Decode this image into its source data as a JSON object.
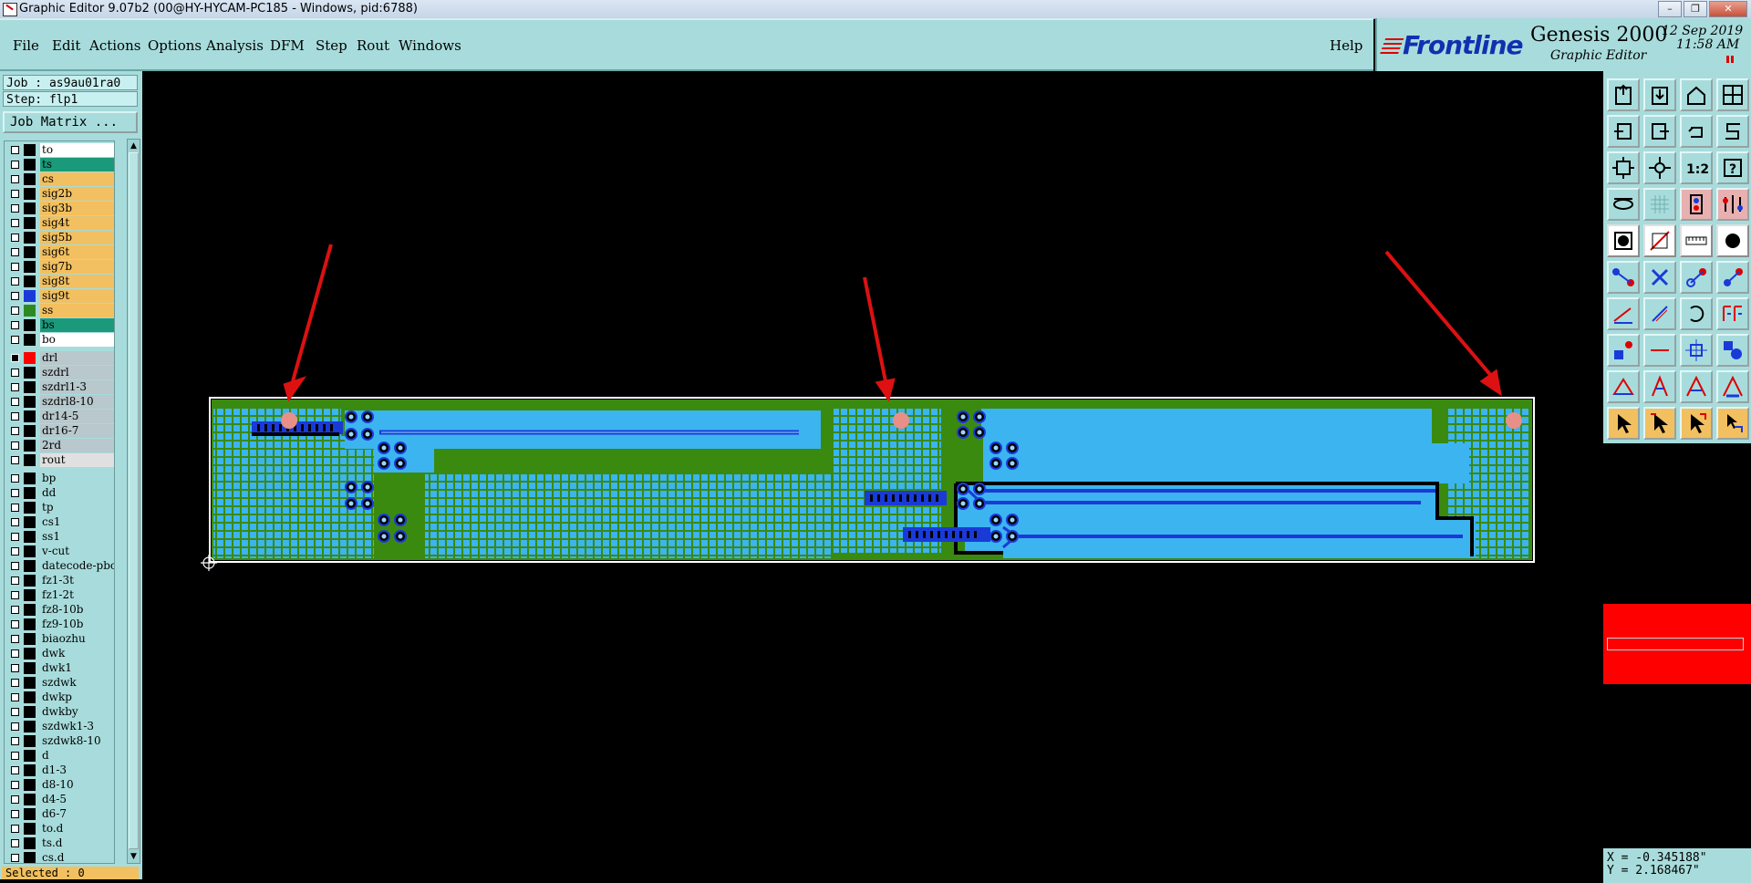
{
  "window": {
    "title": "Graphic Editor 9.07b2 (00@HY-HYCAM-PC185 - Windows, pid:6788)",
    "controls": [
      "–",
      "❐",
      "✕"
    ]
  },
  "menu": {
    "items": [
      "File",
      "Edit",
      "Actions",
      "Options",
      "Analysis",
      "DFM",
      "Step",
      "Rout",
      "Windows"
    ],
    "help": "Help"
  },
  "brand": {
    "logo": "Frontline",
    "product": "Genesis 2000",
    "subtitle": "Graphic Editor",
    "date": "12 Sep 2019",
    "time": "11:58 AM"
  },
  "job": {
    "job_label": "Job : as9au01ra0",
    "step_label": "Step: flp1",
    "matrix_button": "Job Matrix ..."
  },
  "layers": [
    {
      "name": "to",
      "color": "#ffffff",
      "swatch": ""
    },
    {
      "name": "ts",
      "color": "#1a9a7a",
      "swatch": ""
    },
    {
      "name": "cs",
      "color": "#f2c060",
      "swatch": ""
    },
    {
      "name": "sig2b",
      "color": "#f2c060",
      "swatch": ""
    },
    {
      "name": "sig3b",
      "color": "#f2c060",
      "swatch": ""
    },
    {
      "name": "sig4t",
      "color": "#f2c060",
      "swatch": ""
    },
    {
      "name": "sig5b",
      "color": "#f2c060",
      "swatch": ""
    },
    {
      "name": "sig6t",
      "color": "#f2c060",
      "swatch": ""
    },
    {
      "name": "sig7b",
      "color": "#f2c060",
      "swatch": ""
    },
    {
      "name": "sig8t",
      "color": "#f2c060",
      "swatch": ""
    },
    {
      "name": "sig9t",
      "color": "#f2c060",
      "swatch": "#1a3ad8"
    },
    {
      "name": "ss",
      "color": "#f2c060",
      "swatch": "#2e8a20"
    },
    {
      "name": "bs",
      "color": "#1a9a7a",
      "swatch": ""
    },
    {
      "name": "bo",
      "color": "#ffffff",
      "swatch": ""
    },
    {
      "name": "drl",
      "color": "#b8c8cc",
      "swatch": "#ff0000",
      "active": true
    },
    {
      "name": "szdrl",
      "color": "#b8c8cc",
      "swatch": ""
    },
    {
      "name": "szdrl1-3",
      "color": "#b8c8cc",
      "swatch": ""
    },
    {
      "name": "szdrl8-10",
      "color": "#b8c8cc",
      "swatch": ""
    },
    {
      "name": "dr14-5",
      "color": "#b8c8cc",
      "swatch": ""
    },
    {
      "name": "dr16-7",
      "color": "#b8c8cc",
      "swatch": ""
    },
    {
      "name": "2rd",
      "color": "#b8c8cc",
      "swatch": ""
    },
    {
      "name": "rout",
      "color": "#e0e0e0",
      "swatch": ""
    },
    {
      "name": "bp",
      "color": "#a8dcdc",
      "swatch": ""
    },
    {
      "name": "dd",
      "color": "#a8dcdc",
      "swatch": ""
    },
    {
      "name": "tp",
      "color": "#a8dcdc",
      "swatch": ""
    },
    {
      "name": "cs1",
      "color": "#a8dcdc",
      "swatch": ""
    },
    {
      "name": "ss1",
      "color": "#a8dcdc",
      "swatch": ""
    },
    {
      "name": "v-cut",
      "color": "#a8dcdc",
      "swatch": ""
    },
    {
      "name": "datecode-pbo",
      "color": "#a8dcdc",
      "swatch": ""
    },
    {
      "name": "fz1-3t",
      "color": "#a8dcdc",
      "swatch": ""
    },
    {
      "name": "fz1-2t",
      "color": "#a8dcdc",
      "swatch": ""
    },
    {
      "name": "fz8-10b",
      "color": "#a8dcdc",
      "swatch": ""
    },
    {
      "name": "fz9-10b",
      "color": "#a8dcdc",
      "swatch": ""
    },
    {
      "name": "biaozhu",
      "color": "#a8dcdc",
      "swatch": ""
    },
    {
      "name": "dwk",
      "color": "#a8dcdc",
      "swatch": ""
    },
    {
      "name": "dwk1",
      "color": "#a8dcdc",
      "swatch": ""
    },
    {
      "name": "szdwk",
      "color": "#a8dcdc",
      "swatch": ""
    },
    {
      "name": "dwkp",
      "color": "#a8dcdc",
      "swatch": ""
    },
    {
      "name": "dwkby",
      "color": "#a8dcdc",
      "swatch": ""
    },
    {
      "name": "szdwk1-3",
      "color": "#a8dcdc",
      "swatch": ""
    },
    {
      "name": "szdwk8-10",
      "color": "#a8dcdc",
      "swatch": ""
    },
    {
      "name": "d",
      "color": "#a8dcdc",
      "swatch": ""
    },
    {
      "name": "d1-3",
      "color": "#a8dcdc",
      "swatch": ""
    },
    {
      "name": "d8-10",
      "color": "#a8dcdc",
      "swatch": ""
    },
    {
      "name": "d4-5",
      "color": "#a8dcdc",
      "swatch": ""
    },
    {
      "name": "d6-7",
      "color": "#a8dcdc",
      "swatch": ""
    },
    {
      "name": "to.d",
      "color": "#a8dcdc",
      "swatch": ""
    },
    {
      "name": "ts.d",
      "color": "#a8dcdc",
      "swatch": ""
    },
    {
      "name": "cs.d",
      "color": "#a8dcdc",
      "swatch": ""
    }
  ],
  "status": {
    "selected": "Selected : 0",
    "x": "X = -0.345188\"",
    "y": "Y = 2.168467\""
  },
  "colors": {
    "panel": "#a8dcdc",
    "board_green": "#3a8a10",
    "copper_blue": "#3cb4f0",
    "trace_blue": "#1a3ad8",
    "arrow_red": "#dd1111",
    "drill_pink": "#e89088"
  },
  "tools": [
    "new-window-icon",
    "save-view-icon",
    "home-icon",
    "split-view-icon",
    "pan-left-icon",
    "pan-right-icon",
    "redraw-icon",
    "snake-icon",
    "zoom-fit-icon",
    "zoom-center-icon",
    "scale-1-2-icon",
    "help-icon",
    "helicopter-icon",
    "grid-icon",
    "layers-toggle-icon",
    "layers-select-icon",
    "pad-icon",
    "surface-icon",
    "ruler-icon",
    "circle-icon",
    "connect-icon",
    "cross-icon",
    "line-pad-icon",
    "line-pad-alt-icon",
    "line-icon",
    "line-alt-icon",
    "arc-icon",
    "text-icon",
    "feature-move-icon",
    "line-dash-icon",
    "stretch-icon",
    "snap-icon",
    "triangle-icon",
    "angle-a-icon",
    "angle-b-icon",
    "angle-c-icon",
    "pointer-icon",
    "pointer-select-icon",
    "pointer-edit-icon",
    "pointer-measure-icon"
  ]
}
